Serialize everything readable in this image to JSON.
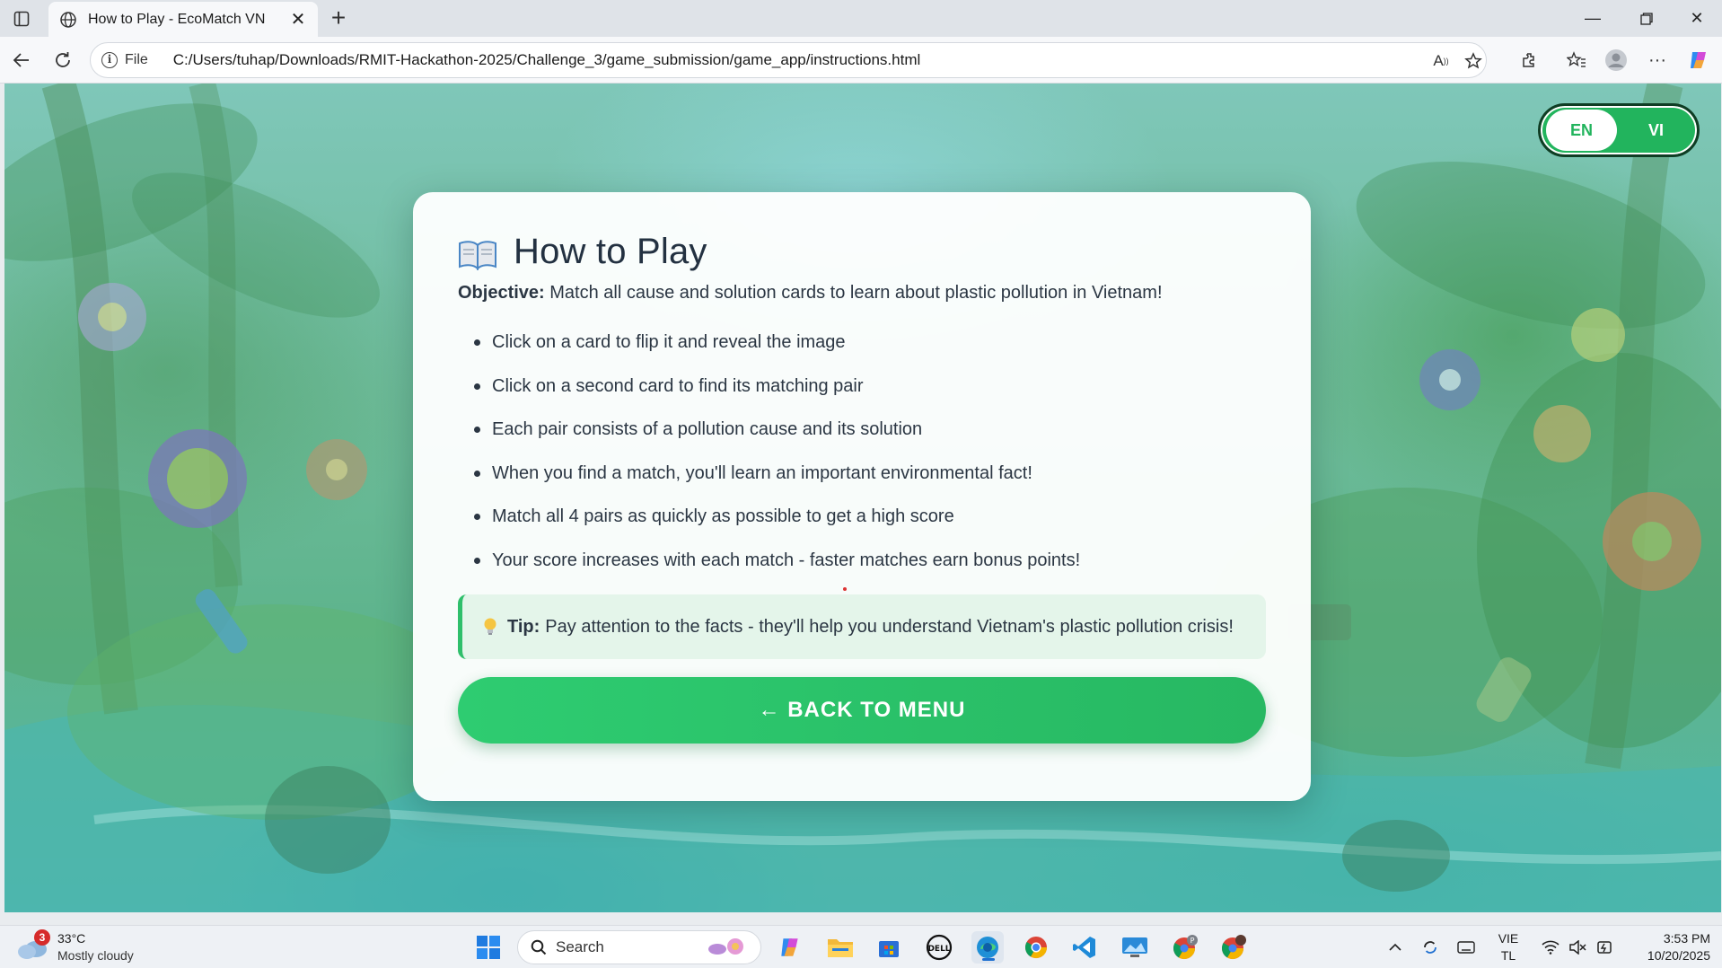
{
  "browser": {
    "tab_title": "How to Play - EcoMatch VN",
    "address_protocol": "File",
    "address_url": "C:/Users/tuhap/Downloads/RMIT-Hackathon-2025/Challenge_3/game_submission/game_app/instructions.html"
  },
  "page": {
    "language_toggle": {
      "en_label": "EN",
      "vi_label": "VI",
      "active": "EN"
    },
    "title": "How to Play",
    "objective_label": "Objective:",
    "objective_text": "Match all cause and solution cards to learn about plastic pollution in Vietnam!",
    "rules": [
      "Click on a card to flip it and reveal the image",
      "Click on a second card to find its matching pair",
      "Each pair consists of a pollution cause and its solution",
      "When you find a match, you'll learn an important environmental fact!",
      "Match all 4 pairs as quickly as possible to get a high score",
      "Your score increases with each match - faster matches earn bonus points!"
    ],
    "tip_label": "Tip:",
    "tip_text": "Pay attention to the facts - they'll help you understand Vietnam's plastic pollution crisis!",
    "back_button": "← BACK TO MENU",
    "colors": {
      "primary_green": "#2ecc71",
      "tip_background": "#e4f5ea",
      "heading": "#233141"
    }
  },
  "taskbar": {
    "weather_badge": "3",
    "weather_temp": "33°C",
    "weather_condition": "Mostly cloudy",
    "search_label": "Search",
    "lang_line1": "VIE",
    "lang_line2": "TL",
    "time": "3:53 PM",
    "date": "10/20/2025"
  }
}
